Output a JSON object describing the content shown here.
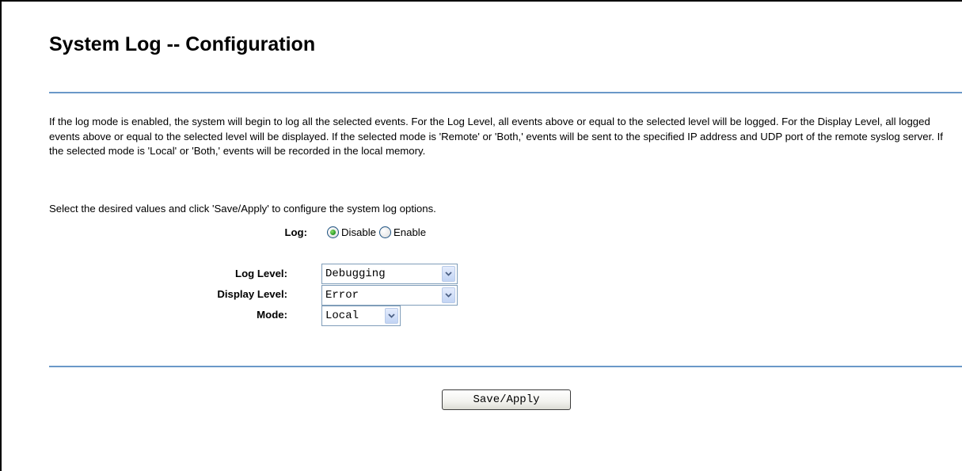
{
  "page": {
    "title": "System Log -- Configuration",
    "description": "If the log mode is enabled, the system will begin to log all the selected events. For the Log Level, all events above or equal to the selected level will be logged. For the Display Level, all logged events above or equal to the selected level will be displayed. If the selected mode is 'Remote' or 'Both,' events will be sent to the specified IP address and UDP port of the remote syslog server. If the selected mode is 'Local' or 'Both,' events will be recorded in the local memory.",
    "instruction": "Select the desired values and click 'Save/Apply' to configure the system log options."
  },
  "log": {
    "label": "Log:",
    "options": [
      {
        "label": "Disable",
        "checked": true
      },
      {
        "label": "Enable",
        "checked": false
      }
    ]
  },
  "log_level": {
    "label": "Log Level:",
    "selected": "Debugging"
  },
  "display_level": {
    "label": "Display Level:",
    "selected": "Error"
  },
  "mode": {
    "label": "Mode:",
    "selected": "Local"
  },
  "actions": {
    "save_label": "Save/Apply"
  },
  "icons": {
    "dropdown": "chevron-down-icon"
  },
  "colors": {
    "divider": "#6a98c8",
    "select_border": "#7f9db9",
    "radio_dot": "#2fa02a"
  }
}
